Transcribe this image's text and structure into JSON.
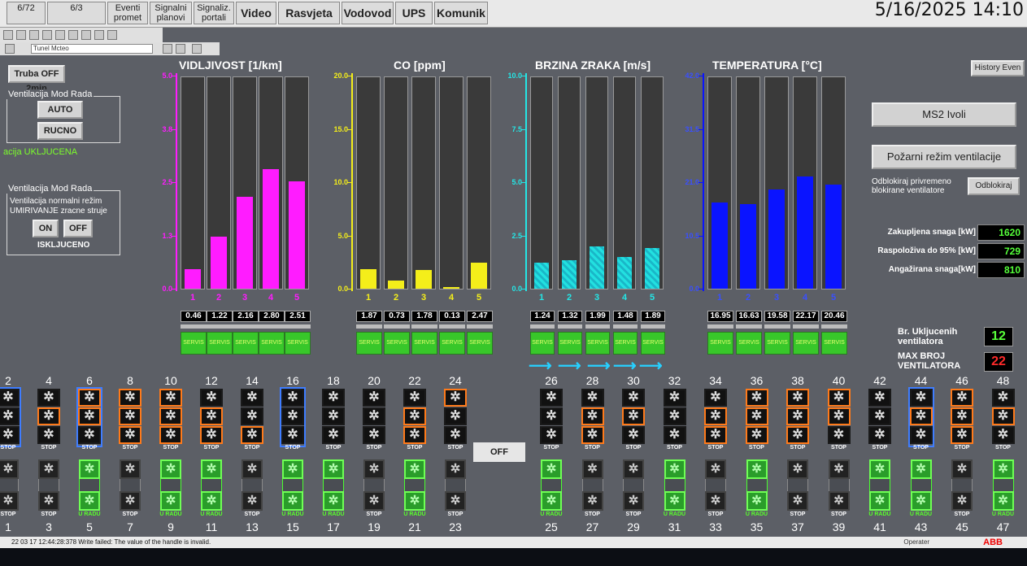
{
  "header": {
    "datetime": "5/16/2025 14:10",
    "tabs": [
      "6/72",
      "6/3",
      "Eventi\npromet",
      "Signalni\nplanovi",
      "Signaliz.\nportali",
      "Video",
      "Rasvjeta",
      "Vodovod",
      "UPS",
      "Komunik"
    ],
    "combo_value": "Tunel Mcteo"
  },
  "left": {
    "truba_label": "Truba OFF 2min",
    "group1_title": "Ventilacija Mod Rada",
    "auto_label": "AUTO",
    "rucno_label": "RUCNO",
    "status_on": "acija UKLJUCENA",
    "group2_title": "Ventilacija Mod Rada",
    "mode_text1": "Ventilacija normalni režim",
    "mode_text2": "UMIRIVANJE zracne struje",
    "on_label": "ON",
    "off_label": "OFF",
    "status_off": "ISKLJUCENO"
  },
  "charts": [
    {
      "title": "VIDLJIVOST [1/km]",
      "color": "#ff1cff",
      "ymax": 5.0,
      "ticks": [
        "5.0",
        "3.8",
        "2.5",
        "1.3",
        "0.0"
      ],
      "indices": [
        "1",
        "2",
        "3",
        "4",
        "5"
      ],
      "values": [
        0.46,
        1.22,
        2.16,
        2.8,
        2.51
      ],
      "labels": [
        "0.46",
        "1.22",
        "2.16",
        "2.80",
        "2.51"
      ]
    },
    {
      "title": "CO [ppm]",
      "color": "#f4ee1a",
      "ymax": 20.0,
      "ticks": [
        "20.0",
        "15.0",
        "10.0",
        "5.0",
        "0.0"
      ],
      "indices": [
        "1",
        "2",
        "3",
        "4",
        "5"
      ],
      "values": [
        1.87,
        0.73,
        1.78,
        0.13,
        2.47
      ],
      "labels": [
        "1.87",
        "0.73",
        "1.78",
        "0.13",
        "2.47"
      ]
    },
    {
      "title": "BRZINA ZRAKA [m/s]",
      "color": "#24e6e6",
      "ymax": 10.0,
      "ticks": [
        "10.0",
        "7.5",
        "5.0",
        "2.5",
        "0.0"
      ],
      "indices": [
        "1",
        "2",
        "3",
        "4",
        "5"
      ],
      "values": [
        1.24,
        1.32,
        1.99,
        1.48,
        1.89
      ],
      "labels": [
        "1.24",
        "1.32",
        "1.99",
        "1.48",
        "1.89"
      ]
    },
    {
      "title": "TEMPERATURA [°C]",
      "color": "#0a14ff",
      "ymax": 42.0,
      "ticks": [
        "42.0",
        "31.5",
        "21.0",
        "10.5",
        "0.0"
      ],
      "indices": [
        "1",
        "2",
        "3",
        "4",
        "5"
      ],
      "values": [
        16.95,
        16.63,
        19.58,
        22.17,
        20.46
      ],
      "labels": [
        "16.95",
        "16.63",
        "19.58",
        "22.17",
        "20.46"
      ]
    }
  ],
  "servis_label": "SERVIS",
  "right": {
    "history_label": "History Even",
    "ms2_label": "MS2  Ivoli",
    "pozar_label": "Požarni režim ventilacije",
    "odblok_text1": "Odblokiraj privremeno",
    "odblok_text2": "blokirane ventilatore",
    "odblok_btn": "Odblokiraj",
    "power": [
      {
        "label": "Zakupljena snaga [kW]",
        "value": "1620"
      },
      {
        "label": "Raspoloživa do 95% [kW]",
        "value": "729"
      },
      {
        "label": "Angažirana snaga[kW]",
        "value": "810"
      }
    ],
    "br_label1": "Br. Ukljucenih",
    "br_label2": "ventilatora",
    "br_value": "12",
    "max_label1": "MAX  BROJ",
    "max_label2": "VENTILATORA",
    "max_value": "22"
  },
  "fans_top": {
    "numbers": [
      "2",
      "4",
      "6",
      "8",
      "10",
      "12",
      "14",
      "16",
      "18",
      "20",
      "22",
      "24",
      "26",
      "28",
      "30",
      "32",
      "34",
      "36",
      "38",
      "40",
      "42",
      "44",
      "46",
      "48"
    ],
    "status": [
      "STOP",
      "STOP",
      "STOP",
      "STOP",
      "STOP",
      "STOP",
      "STOP",
      "STOP",
      "STOP",
      "STOP",
      "STOP",
      "STOP",
      "STOP",
      "STOP",
      "STOP",
      "STOP",
      "STOP",
      "STOP",
      "STOP",
      "STOP",
      "STOP",
      "STOP",
      "STOP",
      "STOP"
    ],
    "frame": [
      "blue",
      "none",
      "blue",
      "none",
      "none",
      "none",
      "none",
      "blue",
      "none",
      "none",
      "none",
      "none",
      "none",
      "none",
      "none",
      "none",
      "none",
      "none",
      "none",
      "none",
      "none",
      "blue",
      "none",
      "none"
    ],
    "orange": [
      [
        0,
        0,
        0
      ],
      [
        0,
        1,
        0
      ],
      [
        1,
        1,
        0
      ],
      [
        1,
        1,
        1
      ],
      [
        1,
        1,
        1
      ],
      [
        0,
        1,
        1
      ],
      [
        0,
        0,
        1
      ],
      [
        0,
        0,
        0
      ],
      [
        0,
        0,
        0
      ],
      [
        0,
        0,
        0
      ],
      [
        0,
        1,
        1
      ],
      [
        1,
        0,
        0
      ],
      [
        0,
        0,
        0
      ],
      [
        0,
        1,
        1
      ],
      [
        0,
        1,
        0
      ],
      [
        0,
        0,
        0
      ],
      [
        0,
        1,
        1
      ],
      [
        1,
        1,
        1
      ],
      [
        1,
        1,
        1
      ],
      [
        1,
        1,
        0
      ],
      [
        0,
        0,
        0
      ],
      [
        0,
        1,
        0
      ],
      [
        1,
        1,
        1
      ],
      [
        0,
        1,
        0
      ]
    ],
    "off_label": "OFF"
  },
  "fans_bottom": {
    "numbers": [
      "1",
      "3",
      "5",
      "7",
      "9",
      "11",
      "13",
      "15",
      "17",
      "19",
      "21",
      "23",
      "25",
      "27",
      "29",
      "31",
      "33",
      "35",
      "37",
      "39",
      "41",
      "43",
      "45",
      "47"
    ],
    "status": [
      "STOP",
      "STOP",
      "U RADU",
      "STOP",
      "U RADU",
      "U RADU",
      "STOP",
      "U RADU",
      "U RADU",
      "STOP",
      "U RADU",
      "STOP",
      "U RADU",
      "STOP",
      "STOP",
      "U RADU",
      "STOP",
      "U RADU",
      "STOP",
      "STOP",
      "U RADU",
      "U RADU",
      "STOP",
      "U RADU"
    ],
    "on": [
      false,
      false,
      true,
      false,
      true,
      true,
      false,
      true,
      true,
      false,
      true,
      false,
      true,
      false,
      false,
      true,
      false,
      true,
      false,
      false,
      true,
      true,
      false,
      true
    ]
  },
  "statusbar": {
    "message": "22 03 17 12:44:28:378    Write failed: The value of the handle is invalid.",
    "operator": "Operater",
    "brand": "ABB"
  }
}
